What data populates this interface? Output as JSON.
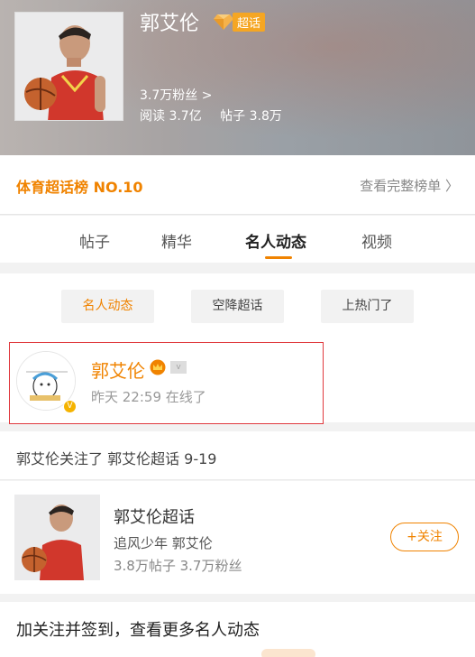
{
  "header": {
    "title": "郭艾伦",
    "badge_label": "超话",
    "fans": "3.7万粉丝 >",
    "reads": "阅读 3.7亿",
    "posts": "帖子 3.8万"
  },
  "ranking": {
    "label": "体育超话榜 NO.10",
    "link": "查看完整榜单 〉"
  },
  "tabs": [
    {
      "label": "帖子"
    },
    {
      "label": "精华"
    },
    {
      "label": "名人动态"
    },
    {
      "label": "视频"
    }
  ],
  "filters": [
    {
      "label": "名人动态"
    },
    {
      "label": "空降超话"
    },
    {
      "label": "上热门了"
    }
  ],
  "celebrity": {
    "name": "郭艾伦",
    "status": "昨天 22:59 在线了"
  },
  "follow_note": "郭艾伦关注了 郭艾伦超话 9-19",
  "topic": {
    "title": "郭艾伦超话",
    "subtitle": "追风少年 郭艾伦",
    "stats": "3.8万帖子  3.7万粉丝",
    "follow_label": "+关注"
  },
  "bottom_prompt": "加关注并签到，查看更多名人动态",
  "colors": {
    "accent": "#f08300",
    "highlight_border": "#e0393e"
  }
}
